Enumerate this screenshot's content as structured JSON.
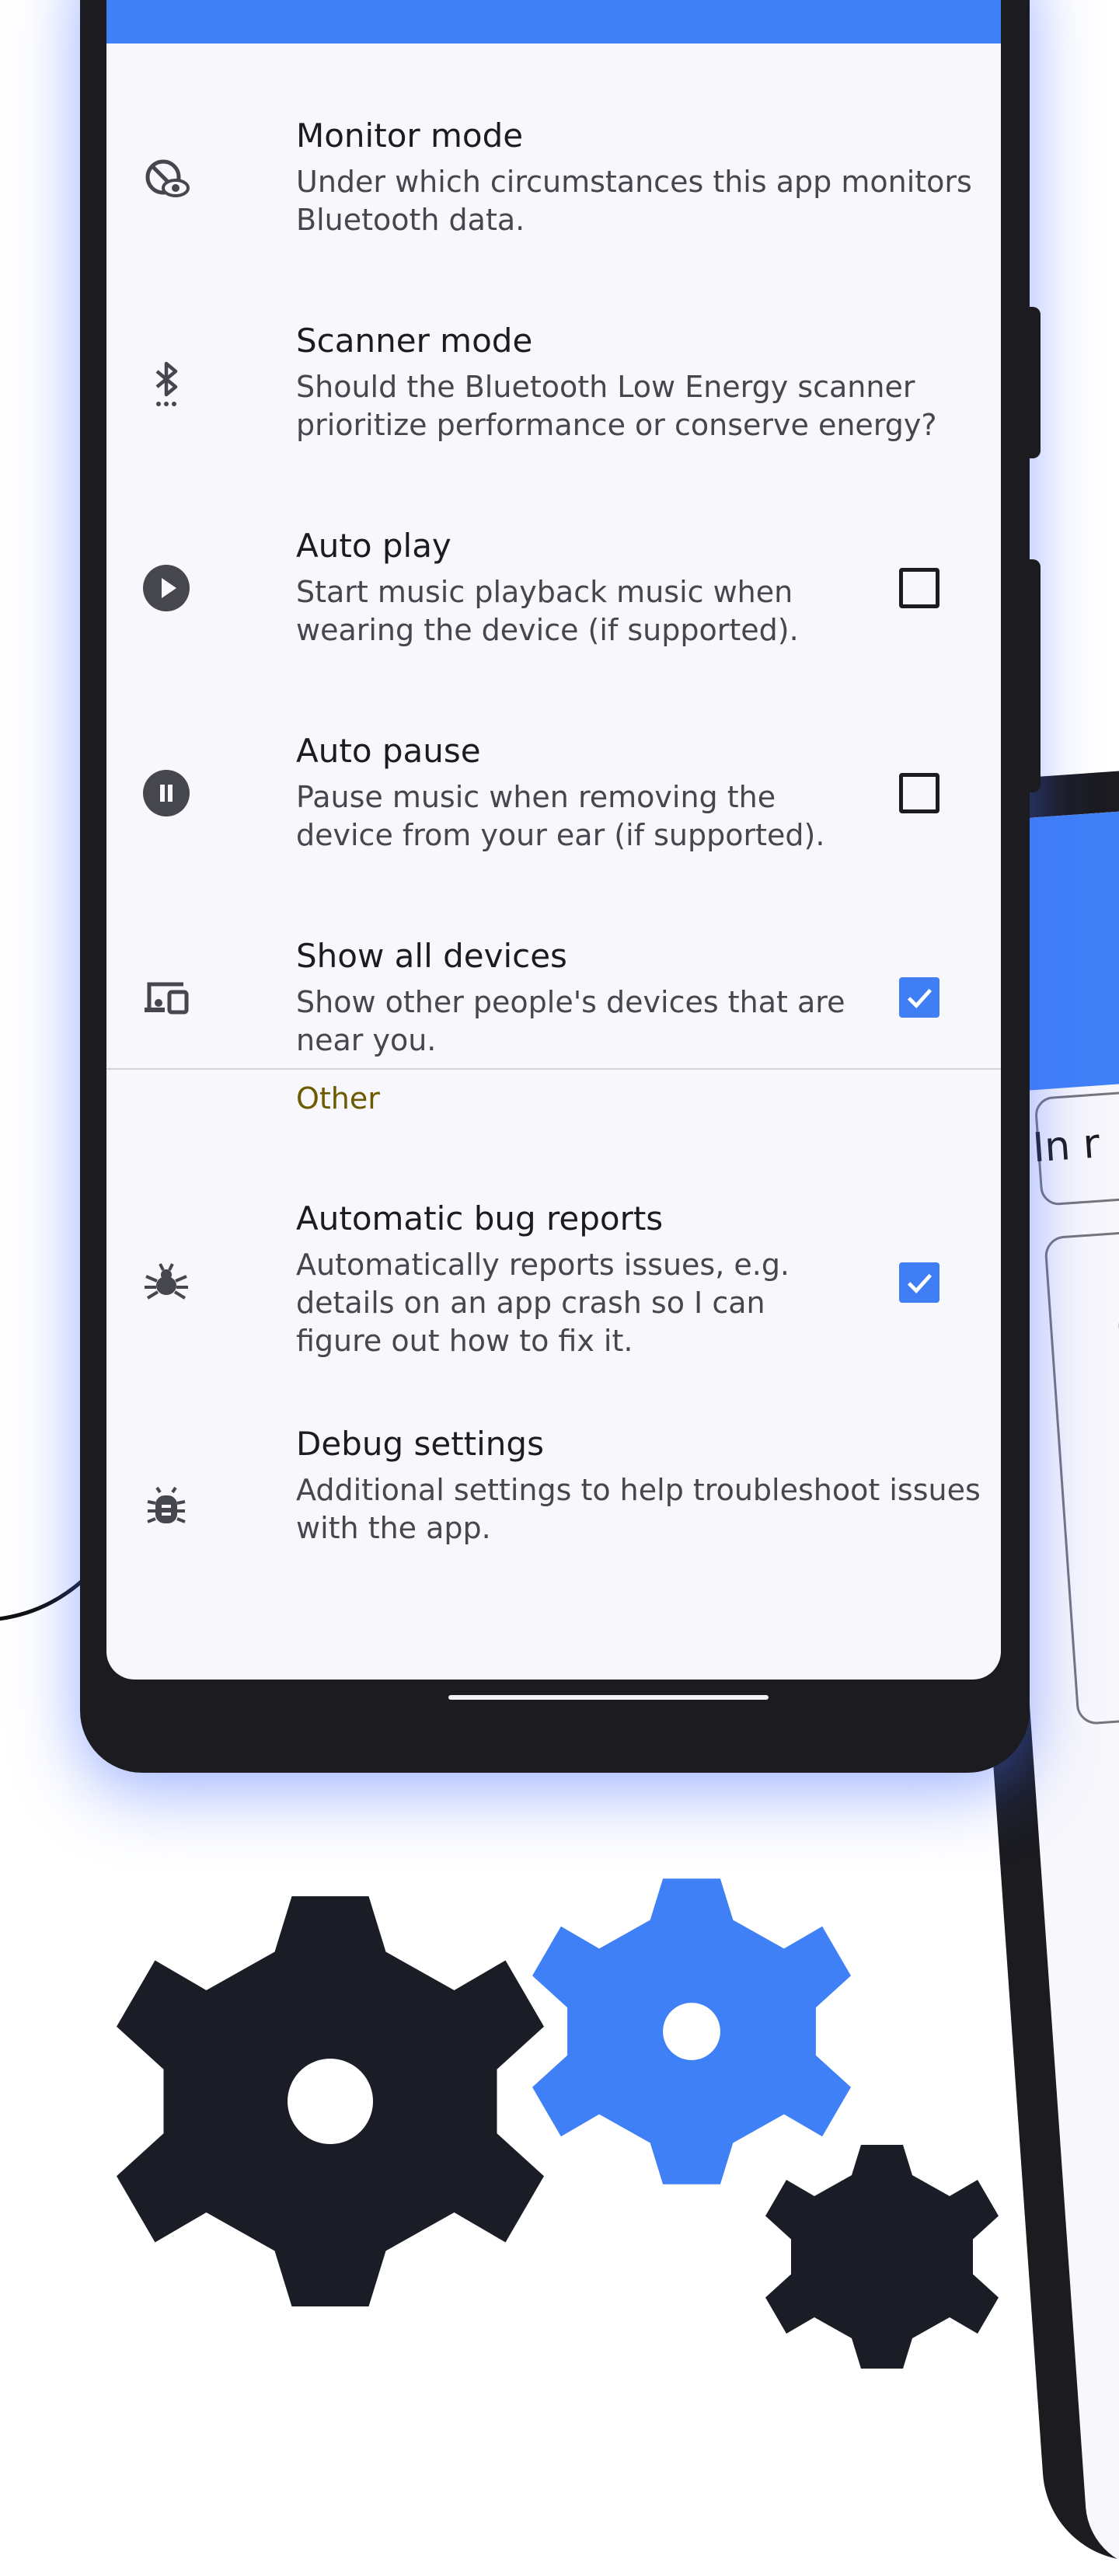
{
  "colors": {
    "accent": "#4080f7",
    "phone_frame": "#1b1b20",
    "screen_bg": "#f8f7fc",
    "section_label": "#6b5c00",
    "gear_dark": "#1a1c26",
    "gear_blue": "#4080f7"
  },
  "settings": {
    "items": [
      {
        "icon": "monitor-eye-icon",
        "title": "Monitor mode",
        "description": "Under which circumstances this app monitors\nBluetooth data."
      },
      {
        "icon": "bluetooth-scan-icon",
        "title": "Scanner mode",
        "description": "Should the Bluetooth Low Energy scanner\nprioritize performance or conserve energy?"
      },
      {
        "icon": "play-circle-icon",
        "title": "Auto play",
        "description": "Start music playback music when\nwearing the device (if supported).",
        "checked": false
      },
      {
        "icon": "pause-circle-icon",
        "title": "Auto pause",
        "description": "Pause music when removing the\ndevice from your ear (if supported).",
        "checked": false
      },
      {
        "icon": "devices-icon",
        "title": "Show all devices",
        "description": "Show other people's devices that are\nnear you.",
        "checked": true
      }
    ],
    "other_section_label": "Other",
    "other_items": [
      {
        "icon": "bug-report-icon",
        "title": "Automatic bug reports",
        "description": "Automatically reports issues, e.g.\ndetails on an app crash so I can\nfigure out how to fix it.",
        "checked": true
      },
      {
        "icon": "debug-bug-icon",
        "title": "Debug settings",
        "description": "Additional settings to help troubleshoot issues\nwith the app."
      }
    ]
  },
  "second_phone": {
    "chip_text": "In r"
  }
}
